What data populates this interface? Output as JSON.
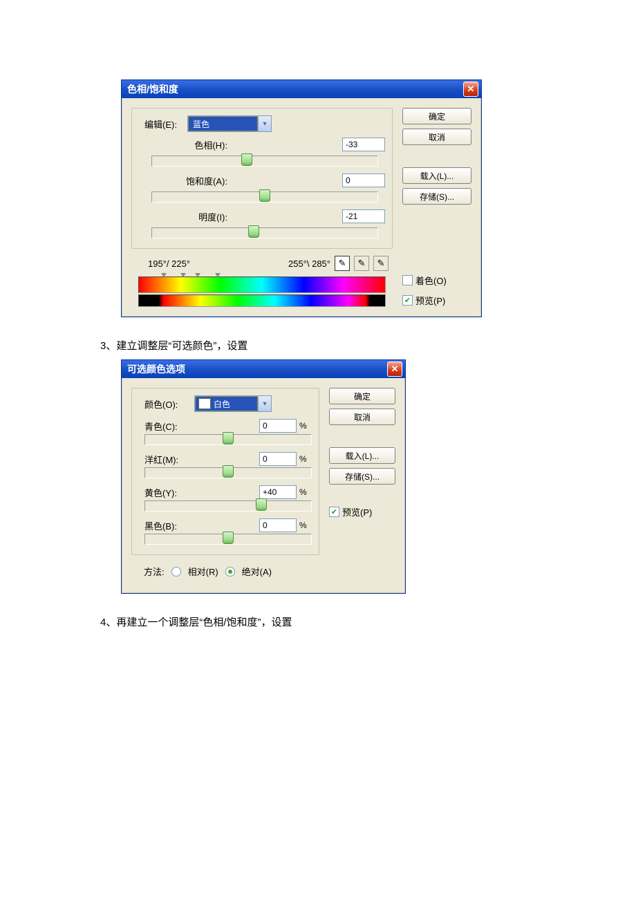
{
  "captions": {
    "c3": "3、建立调整层“可选颜色”，设置",
    "c4": "4、再建立一个调整层“色相/饱和度”，设置"
  },
  "hueSat": {
    "title": "色相/饱和度",
    "editLabel": "编辑(E):",
    "editValue": "蓝色",
    "hueLabel": "色相(H):",
    "hueValue": "-33",
    "satLabel": "饱和度(A):",
    "satValue": "0",
    "lightLabel": "明度(I):",
    "lightValue": "-21",
    "range1": "195°/ 225°",
    "range2": "255°\\ 285°",
    "okLabel": "确定",
    "cancelLabel": "取消",
    "loadLabel": "载入(L)...",
    "saveLabel": "存储(S)...",
    "colorizeLabel": "着色(O)",
    "previewLabel": "预览(P)"
  },
  "selColor": {
    "title": "可选颜色选项",
    "colorsLabel": "颜色(O):",
    "colorsValue": "白色",
    "cyanLabel": "青色(C):",
    "cyanValue": "0",
    "magentaLabel": "洋红(M):",
    "magentaValue": "0",
    "yellowLabel": "黄色(Y):",
    "yellowValue": "+40",
    "blackLabel": "黑色(B):",
    "blackValue": "0",
    "pct": "%",
    "methodLabel": "方法:",
    "relativeLabel": "相对(R)",
    "absoluteLabel": "绝对(A)",
    "okLabel": "确定",
    "cancelLabel": "取消",
    "loadLabel": "载入(L)...",
    "saveLabel": "存储(S)...",
    "previewLabel": "预览(P)"
  }
}
